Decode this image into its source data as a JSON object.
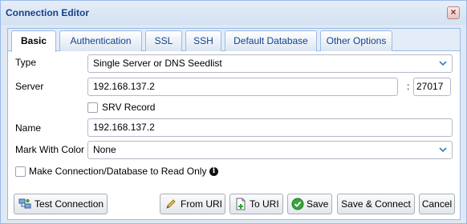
{
  "window": {
    "title": "Connection Editor"
  },
  "tabs": [
    "Basic",
    "Authentication",
    "SSL",
    "SSH",
    "Default Database",
    "Other Options"
  ],
  "form": {
    "type_label": "Type",
    "type_value": "Single Server or DNS Seedlist",
    "server_label": "Server",
    "server_host": "192.168.137.2",
    "port_separator": ":",
    "server_port": "27017",
    "srv_label": "SRV Record",
    "name_label": "Name",
    "name_value": "192.168.137.2",
    "color_label": "Mark With Color",
    "color_value": "None",
    "readonly_label": "Make Connection/Database to Read Only"
  },
  "buttons": {
    "test": "Test Connection",
    "from_uri": "From URI",
    "to_uri": "To URI",
    "save": "Save",
    "save_connect": "Save & Connect",
    "cancel": "Cancel"
  },
  "icons": {
    "close": "close-icon",
    "dropdown": "chevron-down-icon",
    "info": "info-icon",
    "test": "network-test-icon",
    "from_uri": "edit-pencil-icon",
    "to_uri": "document-add-icon",
    "save": "check-circle-icon"
  },
  "colors": {
    "accent": "#15428b",
    "border": "#99bbe8",
    "save_green": "#3aa33a"
  }
}
